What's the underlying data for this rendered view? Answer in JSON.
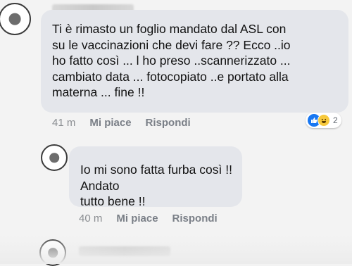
{
  "comments": [
    {
      "text": "Ti è  rimasto un foglio mandato dal ASL con\nsu le vaccinazioni che devi fare ?? Ecco ..io\nho fatto così ... l ho preso ..scannerizzato ...\ncambiato data ... fotocopiato ..e portato alla\nmaterna ...  fine !!",
      "time": "41 m",
      "like_label": "Mi piace",
      "reply_label": "Rispondi",
      "reaction_count": "2",
      "reactions": [
        "like-icon",
        "haha-icon"
      ]
    },
    {
      "text": "Io mi sono fatta furba così !! Andato\ntutto bene !!",
      "time": "40 m",
      "like_label": "Mi piace",
      "reply_label": "Rispondi"
    }
  ],
  "colors": {
    "bubble": "#e4e6eb",
    "like_blue": "#1877f2",
    "haha_yellow": "#f7c93c",
    "meta_gray": "#7a7f87"
  }
}
